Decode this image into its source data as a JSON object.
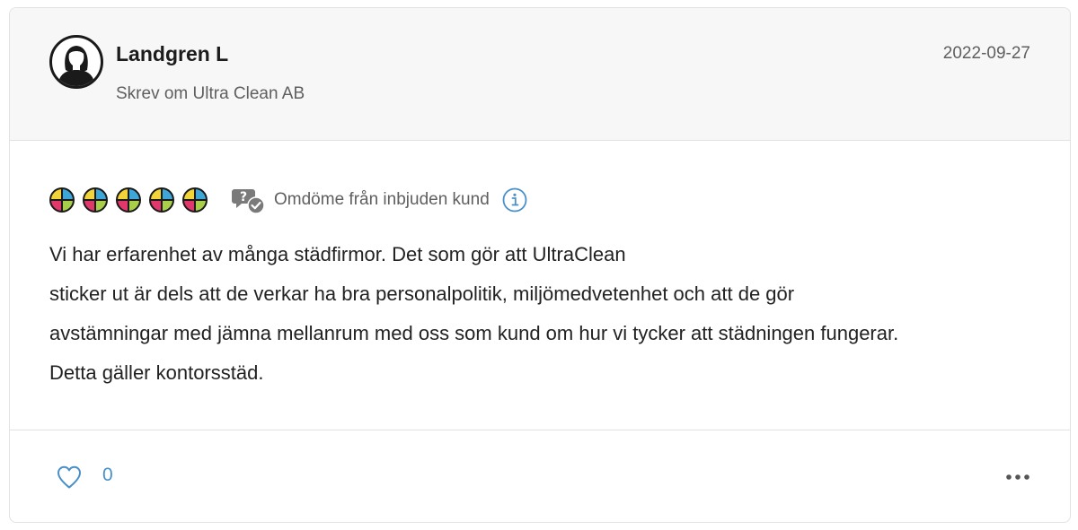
{
  "review": {
    "reviewer_name": "Landgren L",
    "wrote_about": "Skrev om Ultra Clean AB",
    "date": "2022-09-27",
    "rating": 5,
    "rating_max": 5,
    "invited_label": "Omdöme från inbjuden kund",
    "text_lines": [
      "Vi har erfarenhet av många städfirmor. Det som gör att UltraClean",
      "sticker ut är dels att de verkar ha bra personalpolitik, miljömedvetenhet och att de gör",
      "avstämningar med jämna mellanrum med oss som kund om hur vi tycker att städningen fungerar.",
      "Detta gäller kontorsstäd."
    ]
  },
  "footer": {
    "like_count": "0"
  },
  "icons": {
    "avatar": "user-avatar-icon",
    "rating": "rating-star-icon",
    "invited": "chat-bubbles-check-icon",
    "info": "info-icon",
    "like": "heart-icon",
    "more": "more-dots-icon"
  },
  "colors": {
    "star_yellow": "#f3d33a",
    "star_red": "#e0386a",
    "star_blue": "#3fa6d8",
    "star_green": "#a8cf4a",
    "accent_blue": "#4a90c8",
    "header_bg": "#f7f7f7",
    "text_secondary": "#5f5f5f"
  }
}
